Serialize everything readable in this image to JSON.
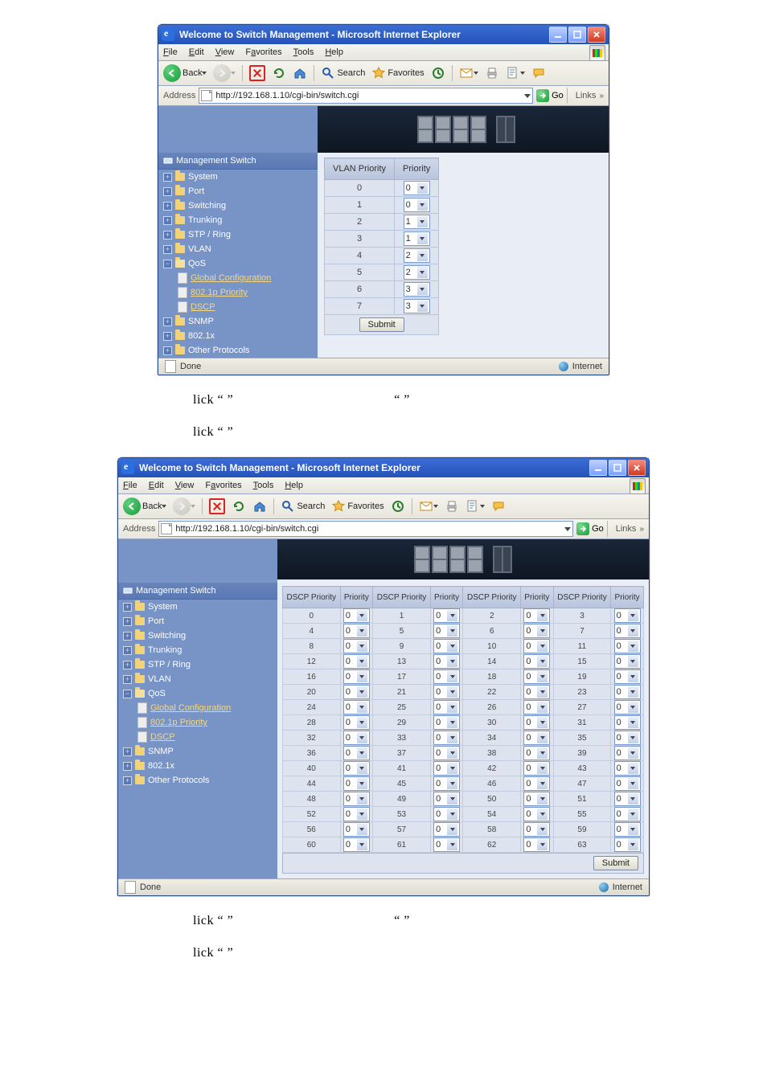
{
  "window": {
    "title": "Welcome to Switch Management - Microsoft Internet Explorer",
    "menus": {
      "file": "File",
      "edit": "Edit",
      "view": "View",
      "favorites": "Favorites",
      "tools": "Tools",
      "help": "Help"
    },
    "toolbar": {
      "back": "Back",
      "search": "Search",
      "favorites": "Favorites"
    },
    "address_label": "Address",
    "address_url": "http://192.168.1.10/cgi-bin/switch.cgi",
    "go": "Go",
    "links": "Links",
    "status_done": "Done",
    "status_zone": "Internet"
  },
  "sidebar": {
    "root": "Management Switch",
    "items": [
      "System",
      "Port",
      "Switching",
      "Trunking",
      "STP / Ring",
      "VLAN",
      "QoS",
      "SNMP",
      "802.1x",
      "Other Protocols"
    ],
    "qos": {
      "gc": "Global Configuration",
      "p8021": "802.1p Priority",
      "dscp": "DSCP"
    }
  },
  "vlan_table": {
    "hdr": {
      "vlan": "VLAN Priority",
      "priority": "Priority"
    },
    "rows": [
      {
        "v": "0",
        "p": "0"
      },
      {
        "v": "1",
        "p": "0"
      },
      {
        "v": "2",
        "p": "1"
      },
      {
        "v": "3",
        "p": "1"
      },
      {
        "v": "4",
        "p": "2"
      },
      {
        "v": "5",
        "p": "2"
      },
      {
        "v": "6",
        "p": "3"
      },
      {
        "v": "7",
        "p": "3"
      }
    ],
    "submit": "Submit"
  },
  "dscp_table": {
    "hdr": {
      "dscp": "DSCP Priority",
      "priority": "Priority"
    },
    "submit": "Submit",
    "default_p": "0",
    "rows": [
      [
        0,
        1,
        2,
        3
      ],
      [
        4,
        5,
        6,
        7
      ],
      [
        8,
        9,
        10,
        11
      ],
      [
        12,
        13,
        14,
        15
      ],
      [
        16,
        17,
        18,
        19
      ],
      [
        20,
        21,
        22,
        23
      ],
      [
        24,
        25,
        26,
        27
      ],
      [
        28,
        29,
        30,
        31
      ],
      [
        32,
        33,
        34,
        35
      ],
      [
        36,
        37,
        38,
        39
      ],
      [
        40,
        41,
        42,
        43
      ],
      [
        44,
        45,
        46,
        47
      ],
      [
        48,
        49,
        50,
        51
      ],
      [
        52,
        53,
        54,
        55
      ],
      [
        56,
        57,
        58,
        59
      ],
      [
        60,
        61,
        62,
        63
      ]
    ]
  },
  "captions": {
    "c1a": "lick “",
    "c1b": "”",
    "cquote1": "”",
    "cquote2": "“",
    "line1_left": "lick “          ”",
    "line1_right": "“          ”",
    "line2": "lick “          ”"
  }
}
